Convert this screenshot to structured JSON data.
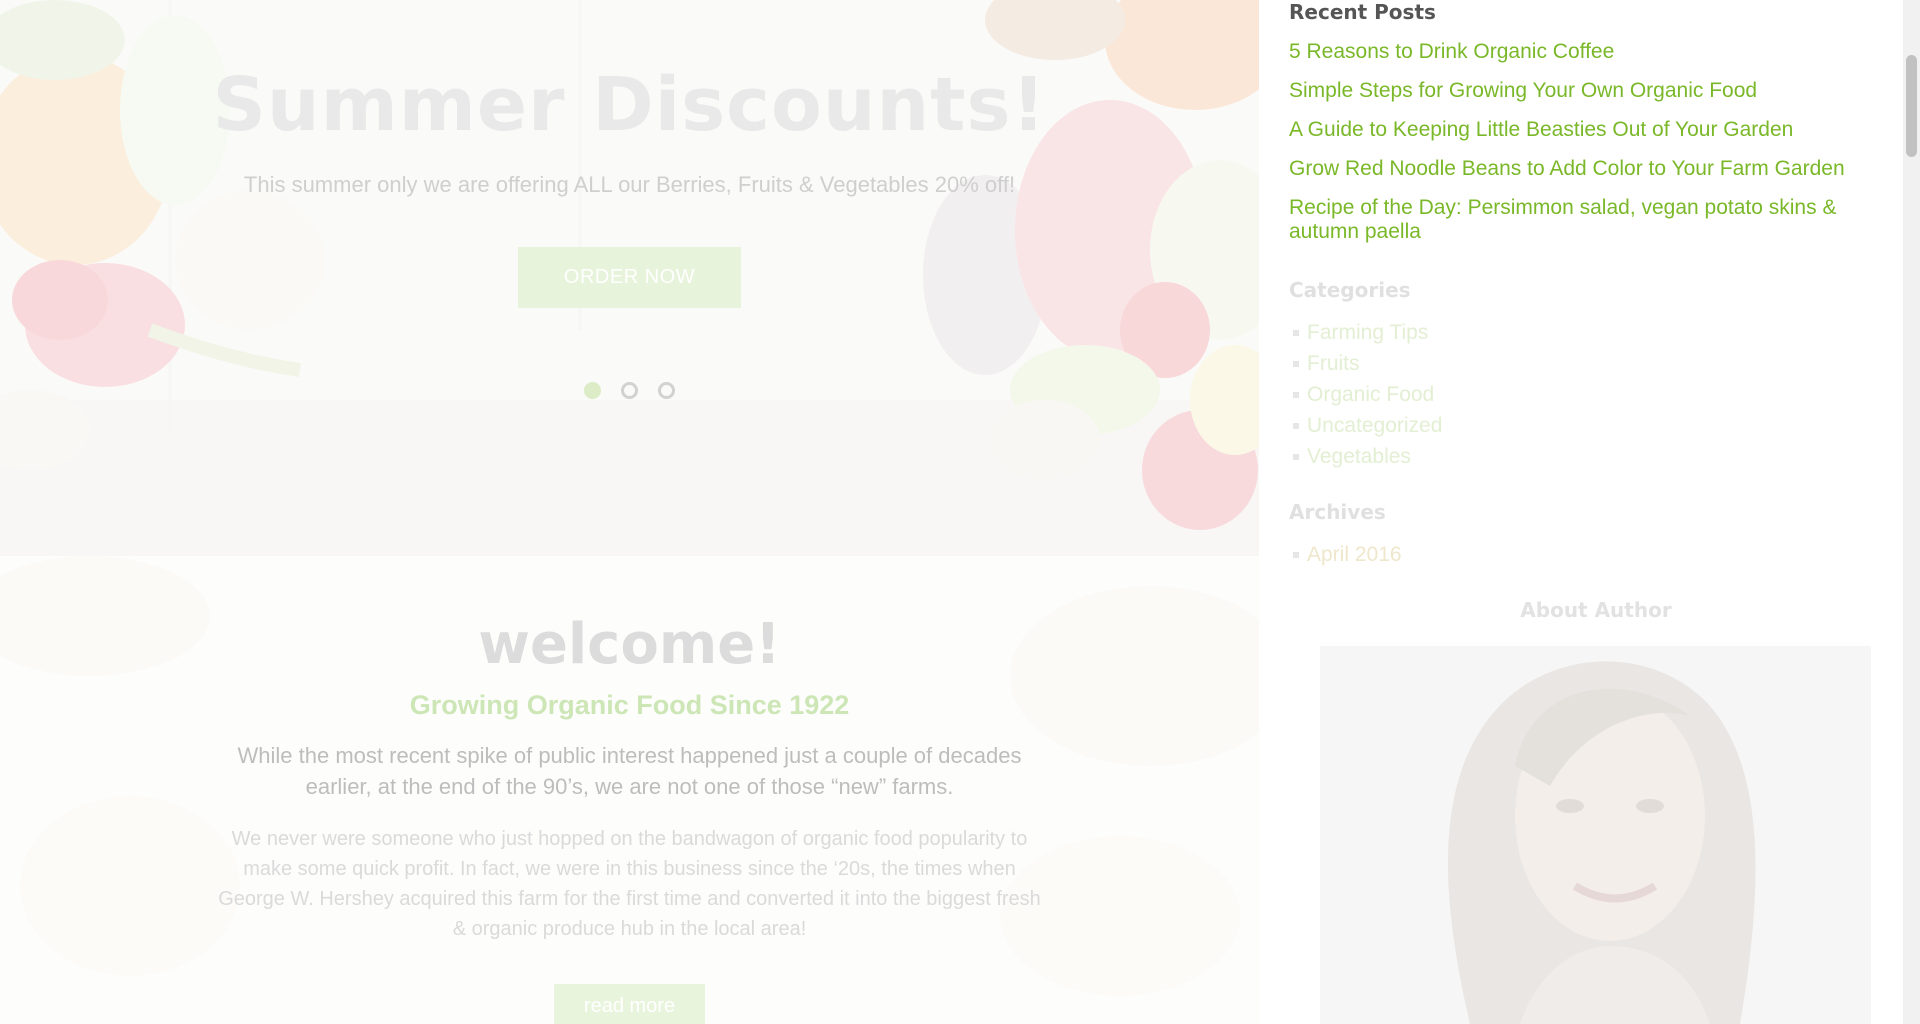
{
  "hero": {
    "title": "Summer Discounts!",
    "subtitle": "This summer only we are offering ALL our Berries, Fruits & Vegetables 20% off!",
    "button_label": "ORDER NOW",
    "slides_total": 3,
    "active_slide": 1
  },
  "welcome": {
    "title": "welcome!",
    "subtitle": "Growing Organic Food Since 1922",
    "lead": "While the most recent spike of public interest happened just a couple of decades earlier, at the end of the 90’s, we are not one of those “new” farms.",
    "body": "We never were someone who just hopped on the bandwagon of organic food popularity to make some quick profit. In fact, we were in this business since the ‘20s, the times when George W. Hershey acquired this farm for the first time and converted it into the biggest fresh & organic produce hub in the local area!",
    "button_label": "read more"
  },
  "sidebar": {
    "recent_posts": {
      "title": "Recent Posts",
      "items": [
        "5 Reasons to Drink Organic Coffee",
        "Simple Steps for Growing Your Own Organic Food",
        "A Guide to Keeping Little Beasties Out of Your Garden",
        "Grow Red Noodle Beans to Add Color to Your Farm Garden",
        "Recipe of the Day: Persimmon salad, vegan potato skins & autumn paella"
      ]
    },
    "categories": {
      "title": "Categories",
      "items": [
        "Farming Tips",
        "Fruits",
        "Organic Food",
        "Uncategorized",
        "Vegetables"
      ]
    },
    "archives": {
      "title": "Archives",
      "items": [
        "April 2016"
      ]
    },
    "about_author": {
      "title": "About Author"
    }
  },
  "colors": {
    "link_green": "#7ab829",
    "faded_green": "#cde6b6",
    "heading_gray": "#555555"
  }
}
